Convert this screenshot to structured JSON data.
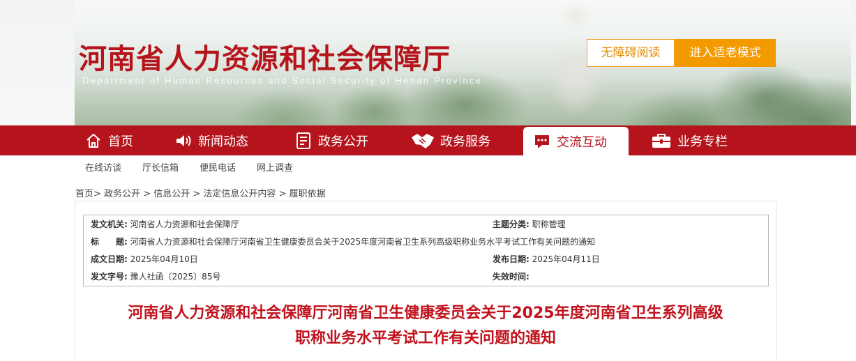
{
  "header": {
    "site_title": "河南省人力资源和社会保障厅",
    "site_subtitle": "Department of Human Resources and Social Security of Henan Province",
    "accessibility_label": "无障碍阅读",
    "elder_mode_label": "进入适老模式"
  },
  "nav": {
    "items": [
      {
        "label": "首页",
        "icon": "home-icon"
      },
      {
        "label": "新闻动态",
        "icon": "speaker-icon"
      },
      {
        "label": "政务公开",
        "icon": "document-icon"
      },
      {
        "label": "政务服务",
        "icon": "handshake-icon"
      },
      {
        "label": "交流互动",
        "icon": "chat-icon"
      },
      {
        "label": "业务专栏",
        "icon": "briefcase-icon"
      }
    ],
    "active": "交流互动",
    "colors": {
      "bar": "#b5141c",
      "active_text": "#b5141c"
    }
  },
  "subnav": [
    "在线访谈",
    "厅长信箱",
    "便民电话",
    "网上调查"
  ],
  "breadcrumb": [
    "首页",
    "政务公开",
    "信息公开",
    "法定信息公开内容",
    "履职依据"
  ],
  "meta": {
    "issuer_label": "发文机关:",
    "issuer": "河南省人力资源和社会保障厅",
    "topic_label": "主题分类:",
    "topic": "职称管理",
    "title_label": "标　　题:",
    "title": "河南省人力资源和社会保障厅河南省卫生健康委员会关于2025年度河南省卫生系列高级职称业务水平考试工作有关问题的通知",
    "created_label": "成文日期:",
    "created": "2025年04月10日",
    "published_label": "发布日期:",
    "published": "2025年04月11日",
    "doc_no_label": "发文字号:",
    "doc_no": "豫人社函〔2025〕85号",
    "expiry_label": "失效时间:",
    "expiry": ""
  },
  "article": {
    "title_line1": "河南省人力资源和社会保障厅河南省卫生健康委员会关于2025年度河南省卫生系列高级",
    "title_line2": "职称业务水平考试工作有关问题的通知"
  }
}
